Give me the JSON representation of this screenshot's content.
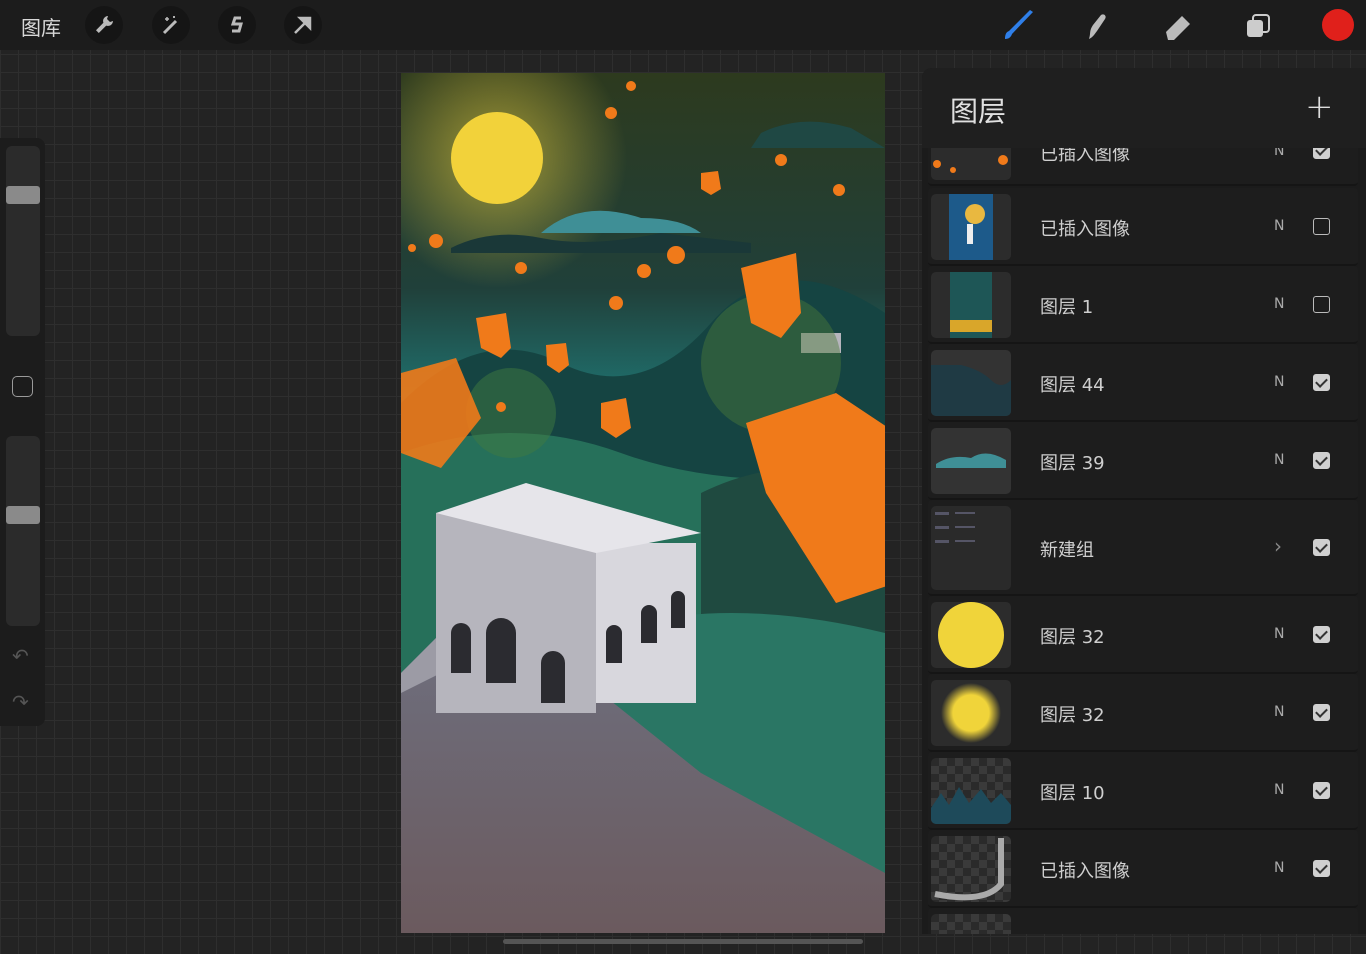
{
  "topbar": {
    "gallery_label": "图库",
    "tools": [
      "wrench-icon",
      "magic-wand-icon",
      "selection-s-icon",
      "move-arrow-icon"
    ],
    "right_tools": [
      "brush-icon",
      "smudge-icon",
      "eraser-icon",
      "layers-icon"
    ],
    "current_color": "#e0201b"
  },
  "layers_panel": {
    "title": "图层",
    "layers": [
      {
        "name": "已插入图像",
        "blend": "N",
        "visible": true
      },
      {
        "name": "已插入图像",
        "blend": "N",
        "visible": false
      },
      {
        "name": "图层 1",
        "blend": "N",
        "visible": false
      },
      {
        "name": "图层 44",
        "blend": "N",
        "visible": true
      },
      {
        "name": "图层 39",
        "blend": "N",
        "visible": true
      },
      {
        "name": "新建组",
        "blend": "group",
        "visible": true
      },
      {
        "name": "图层 32",
        "blend": "N",
        "visible": true
      },
      {
        "name": "图层 32",
        "blend": "N",
        "visible": true
      },
      {
        "name": "图层 10",
        "blend": "N",
        "visible": true
      },
      {
        "name": "已插入图像",
        "blend": "N",
        "visible": true
      }
    ]
  }
}
